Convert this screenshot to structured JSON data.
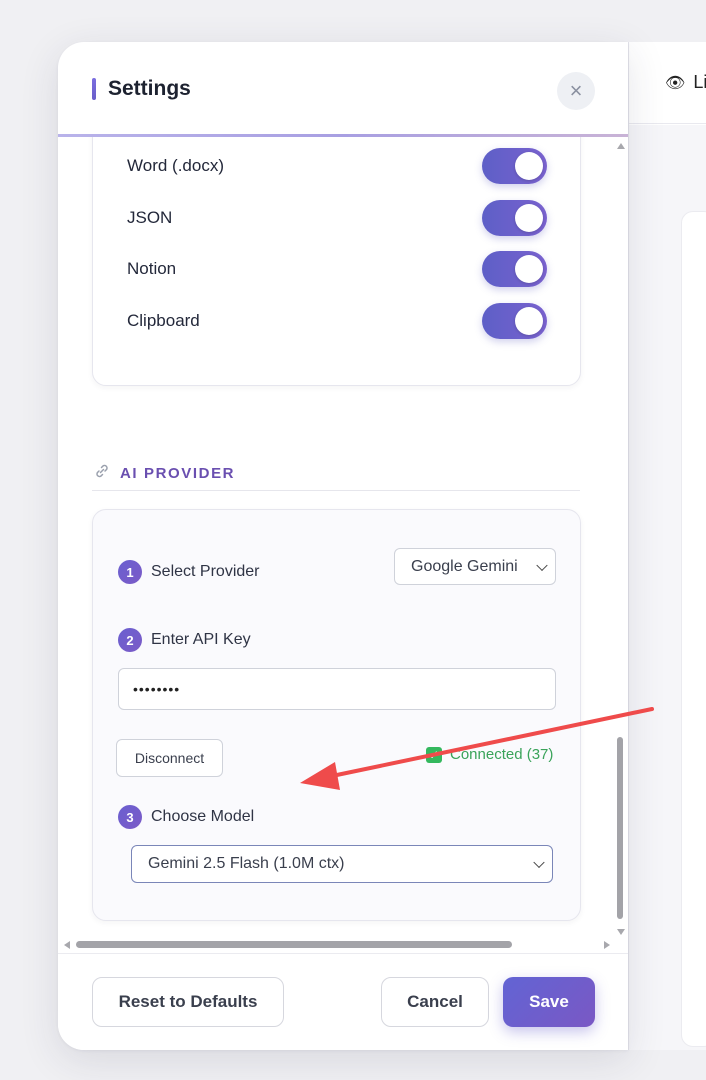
{
  "background": {
    "header_text": "Li",
    "eye_icon": "eye-icon"
  },
  "settings": {
    "title": "Settings",
    "close_icon": "×"
  },
  "export": {
    "toggles": [
      {
        "label": "Word (.docx)",
        "on": true
      },
      {
        "label": "JSON",
        "on": true
      },
      {
        "label": "Notion",
        "on": true
      },
      {
        "label": "Clipboard",
        "on": true
      }
    ]
  },
  "ai_provider": {
    "heading": "AI PROVIDER",
    "steps": [
      {
        "number": "1",
        "label": "Select Provider"
      },
      {
        "number": "2",
        "label": "Enter API Key"
      },
      {
        "number": "3",
        "label": "Choose Model"
      }
    ],
    "provider_value": "Google Gemini",
    "api_key_value": "••••••••",
    "disconnect_label": "Disconnect",
    "status_text": "Connected (37)",
    "model_value": "Gemini 2.5 Flash (1.0M ctx)"
  },
  "footer": {
    "reset_label": "Reset to Defaults",
    "cancel_label": "Cancel",
    "save_label": "Save"
  },
  "colors": {
    "accent": "#6a5fd0",
    "status_green": "#3aa35a",
    "arrow": "#ef4b4b"
  }
}
